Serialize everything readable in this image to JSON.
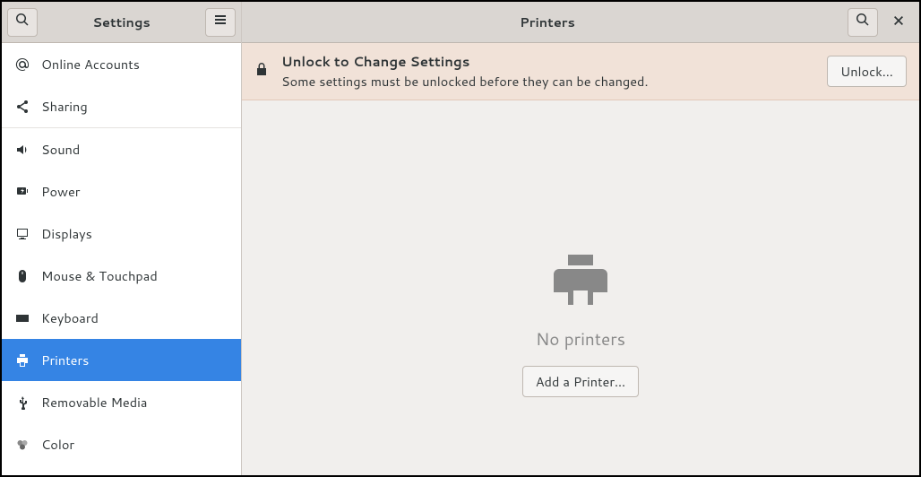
{
  "sidebar": {
    "title": "Settings",
    "items": [
      {
        "label": "Online Accounts",
        "icon": "at-icon"
      },
      {
        "label": "Sharing",
        "icon": "share-icon",
        "divider_after": true
      },
      {
        "label": "Sound",
        "icon": "sound-icon"
      },
      {
        "label": "Power",
        "icon": "power-icon"
      },
      {
        "label": "Displays",
        "icon": "display-icon"
      },
      {
        "label": "Mouse & Touchpad",
        "icon": "mouse-icon"
      },
      {
        "label": "Keyboard",
        "icon": "keyboard-icon"
      },
      {
        "label": "Printers",
        "icon": "printer-icon",
        "selected": true
      },
      {
        "label": "Removable Media",
        "icon": "usb-icon"
      },
      {
        "label": "Color",
        "icon": "color-icon"
      }
    ]
  },
  "main": {
    "title": "Printers"
  },
  "infobar": {
    "title": "Unlock to Change Settings",
    "subtitle": "Some settings must be unlocked before they can be changed.",
    "unlock_label": "Unlock…"
  },
  "empty": {
    "text": "No printers",
    "add_label": "Add a Printer…"
  }
}
